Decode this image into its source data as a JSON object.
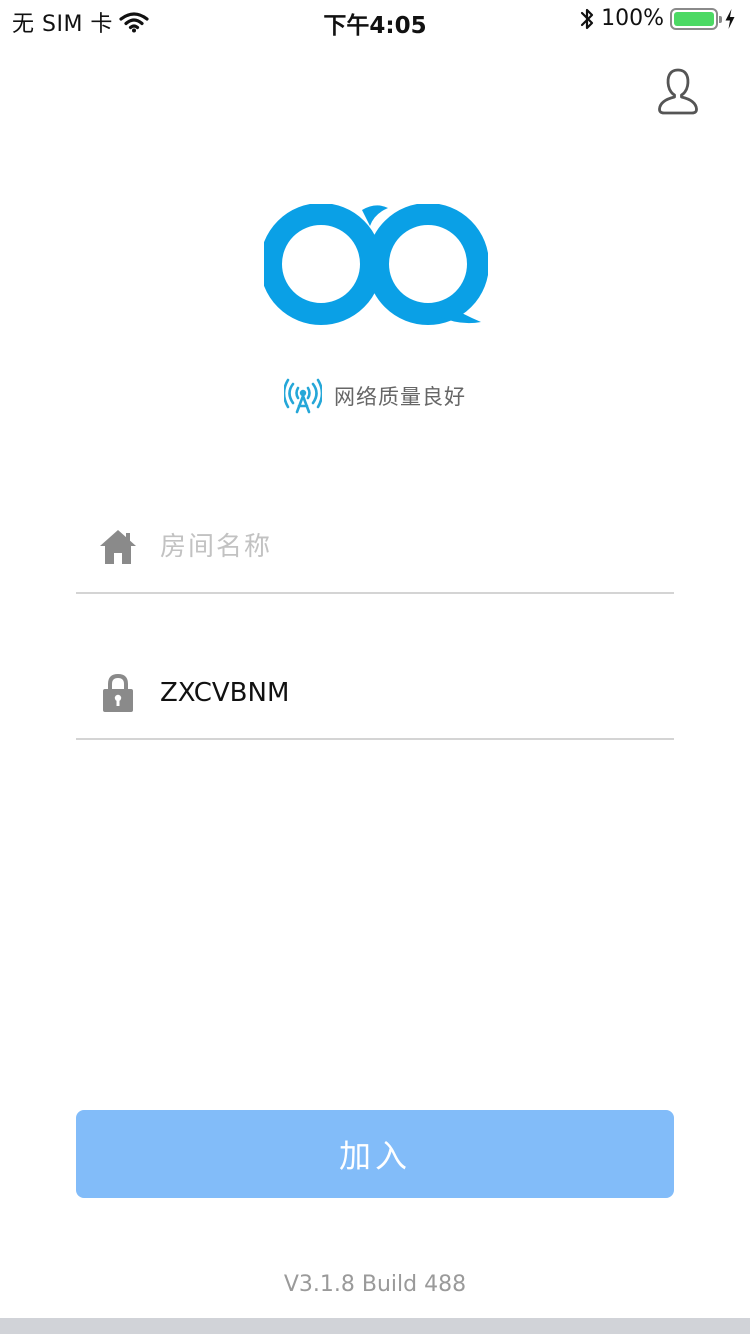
{
  "status_bar": {
    "carrier": "无 SIM 卡",
    "time": "下午4:05",
    "battery": "100%",
    "battery_level": 1.0
  },
  "header": {
    "user_icon": "user-icon"
  },
  "logo": {
    "icon": "app-logo-icon",
    "color": "#0aa0e6"
  },
  "network": {
    "icon": "signal-tower-icon",
    "label": "网络质量良好",
    "color": "#25a7d8"
  },
  "form": {
    "room": {
      "icon": "home-icon",
      "placeholder": "房间名称",
      "value": ""
    },
    "password": {
      "icon": "lock-icon",
      "value": "ZXCVBNM"
    },
    "join_label": "加入",
    "join_color": "#82bcf9"
  },
  "footer": {
    "version": "V3.1.8 Build 488"
  }
}
